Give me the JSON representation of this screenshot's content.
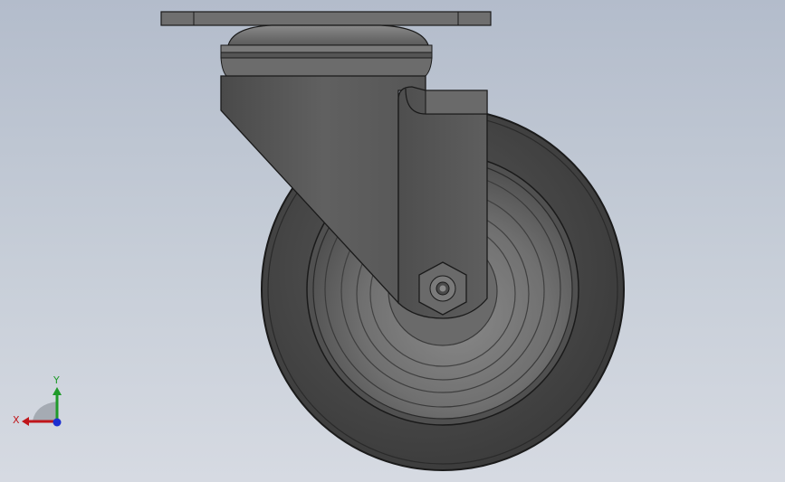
{
  "viewport": {
    "background_top": "#b3bccb",
    "background_bottom": "#d6dae2",
    "model": "swivel-caster"
  },
  "triad": {
    "x_label": "X",
    "y_label": "Y",
    "x_color": "#c0161b",
    "y_color": "#1f9a2a",
    "z_color": "#1c2fd1"
  },
  "colors": {
    "tire": "#4a4a4a",
    "hub": "#6b6b6b",
    "bracket": "#5c5c5c",
    "plate": "#6f6f6f",
    "edge": "#1a1a1a"
  }
}
